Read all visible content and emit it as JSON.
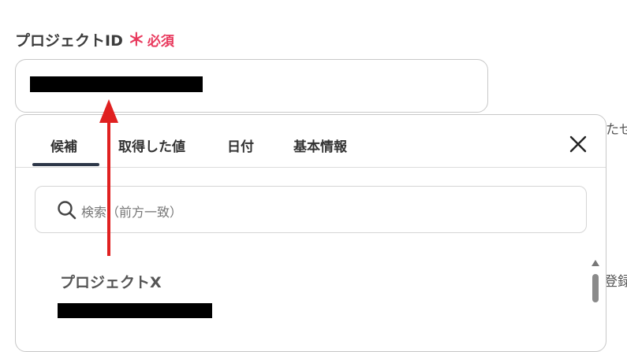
{
  "field": {
    "label": "プロジェクトID",
    "required_mark": "＊",
    "required_text": "必須"
  },
  "background": {
    "right_text_1": "たせ",
    "right_text_2": "登録"
  },
  "popup": {
    "tabs": [
      {
        "label": "候補",
        "active": true
      },
      {
        "label": "取得した値",
        "active": false
      },
      {
        "label": "日付",
        "active": false
      },
      {
        "label": "基本情報",
        "active": false
      }
    ],
    "close_icon": "close-icon",
    "search": {
      "placeholder": "検索（前方一致）",
      "icon": "search-icon"
    },
    "candidates": [
      {
        "title": "プロジェクトX"
      }
    ]
  },
  "colors": {
    "required": "#e8385c",
    "annotation_arrow": "#e02020",
    "active_tab_underline": "#2d3748"
  }
}
